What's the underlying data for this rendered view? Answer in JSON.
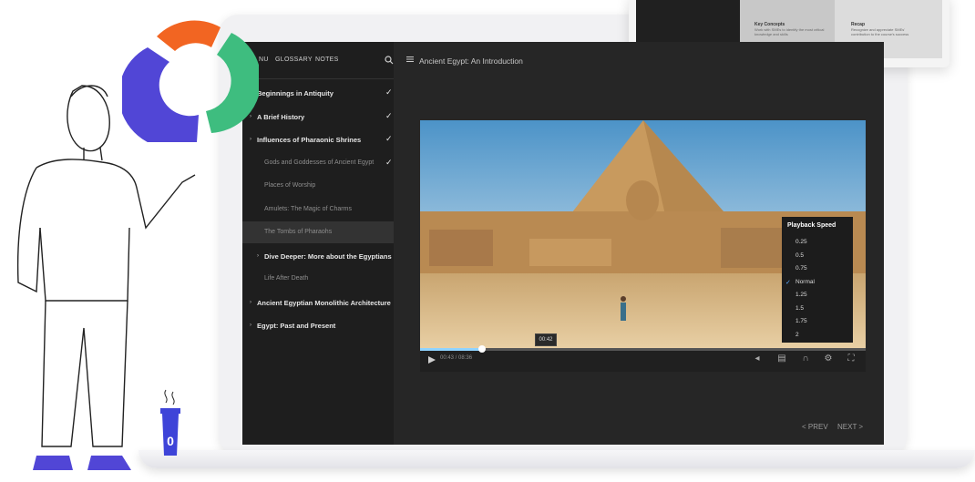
{
  "sidebar": {
    "menu_links": [
      "NU",
      "GLOSSARY",
      "NOTES"
    ],
    "items": [
      {
        "label": "Beginnings in Antiquity",
        "chevron": false,
        "check": true,
        "kind": "bold"
      },
      {
        "label": "A Brief History",
        "chevron": true,
        "check": true,
        "kind": "bold"
      },
      {
        "label": "Influences of Pharaonic Shrines",
        "chevron": true,
        "check": true,
        "kind": "bold"
      },
      {
        "label": "Gods and Goddesses of Ancient Egypt",
        "chevron": false,
        "check": true,
        "kind": "sub"
      },
      {
        "label": "Places of Worship",
        "chevron": false,
        "check": false,
        "kind": "sub"
      },
      {
        "label": "Amulets: The Magic of Charms",
        "chevron": false,
        "check": false,
        "kind": "sub"
      },
      {
        "label": "The Tombs of Pharaohs",
        "chevron": false,
        "check": false,
        "kind": "sub-active"
      },
      {
        "label": "Dive Deeper: More about the Egyptians",
        "chevron": true,
        "check": false,
        "kind": "bold-indent"
      },
      {
        "label": "Life After Death",
        "chevron": false,
        "check": false,
        "kind": "sub"
      },
      {
        "label": "Ancient Egyptian Monolithic Architecture",
        "chevron": true,
        "check": false,
        "kind": "bold"
      },
      {
        "label": "Egypt: Past and Present",
        "chevron": true,
        "check": false,
        "kind": "bold"
      }
    ]
  },
  "main": {
    "title": "Ancient Egypt: An Introduction",
    "time": "00:43 / 08:36",
    "tooltip": "00:42",
    "progress": 0.14,
    "prev": "< PREV",
    "next": "NEXT >"
  },
  "speed_menu": {
    "title": "Playback Speed",
    "options": [
      "0.25",
      "0.5",
      "0.75",
      "Normal",
      "1.25",
      "1.5",
      "1.75",
      "2"
    ],
    "selected": "Normal"
  },
  "card": {
    "col1_title": "Key Concepts",
    "col1_text": "Work with SMEs to identify the most critical knowledge and skills",
    "col2_title": "Recap",
    "col2_text": "Recognize and appreciate SMEs' contribution to the course's success"
  },
  "cup_number": "0",
  "colors": {
    "screen_bg": "#262626",
    "sidebar_bg": "#1e1e1e",
    "accent_blue": "#5aa9ff",
    "logo_orange": "#f26522",
    "logo_green": "#3ebd7f",
    "logo_purple": "#5146d6",
    "cup_blue": "#3e44d8"
  }
}
